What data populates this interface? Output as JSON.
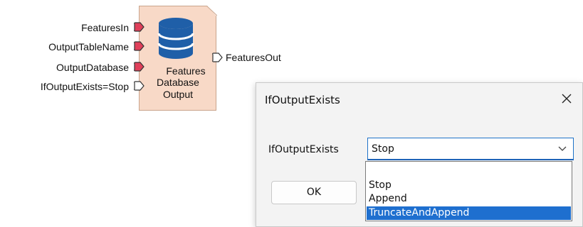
{
  "workflow": {
    "input_ports": [
      {
        "label": "FeaturesIn"
      },
      {
        "label": "OutputTableName"
      },
      {
        "label": "OutputDatabase"
      },
      {
        "label": "IfOutputExists=Stop"
      }
    ],
    "node": {
      "title_lines": [
        "Features",
        "Database",
        "Output"
      ],
      "icon": "database-icon",
      "fill_color": "#f8d9c7"
    },
    "output_ports": [
      {
        "label": "FeaturesOut"
      }
    ]
  },
  "dialog": {
    "title": "IfOutputExists",
    "close_icon": "close-icon",
    "field_label": "IfOutputExists",
    "select": {
      "value": "Stop",
      "options": [
        "Stop",
        "Append",
        "TruncateAndAppend"
      ],
      "highlighted_option": "TruncateAndAppend"
    },
    "ok_label": "OK"
  },
  "colors": {
    "required_port": "#e0405a",
    "optional_port": "#ffffff",
    "icon_blue": "#1f5fa8",
    "selection_blue": "#1e6fcf"
  }
}
